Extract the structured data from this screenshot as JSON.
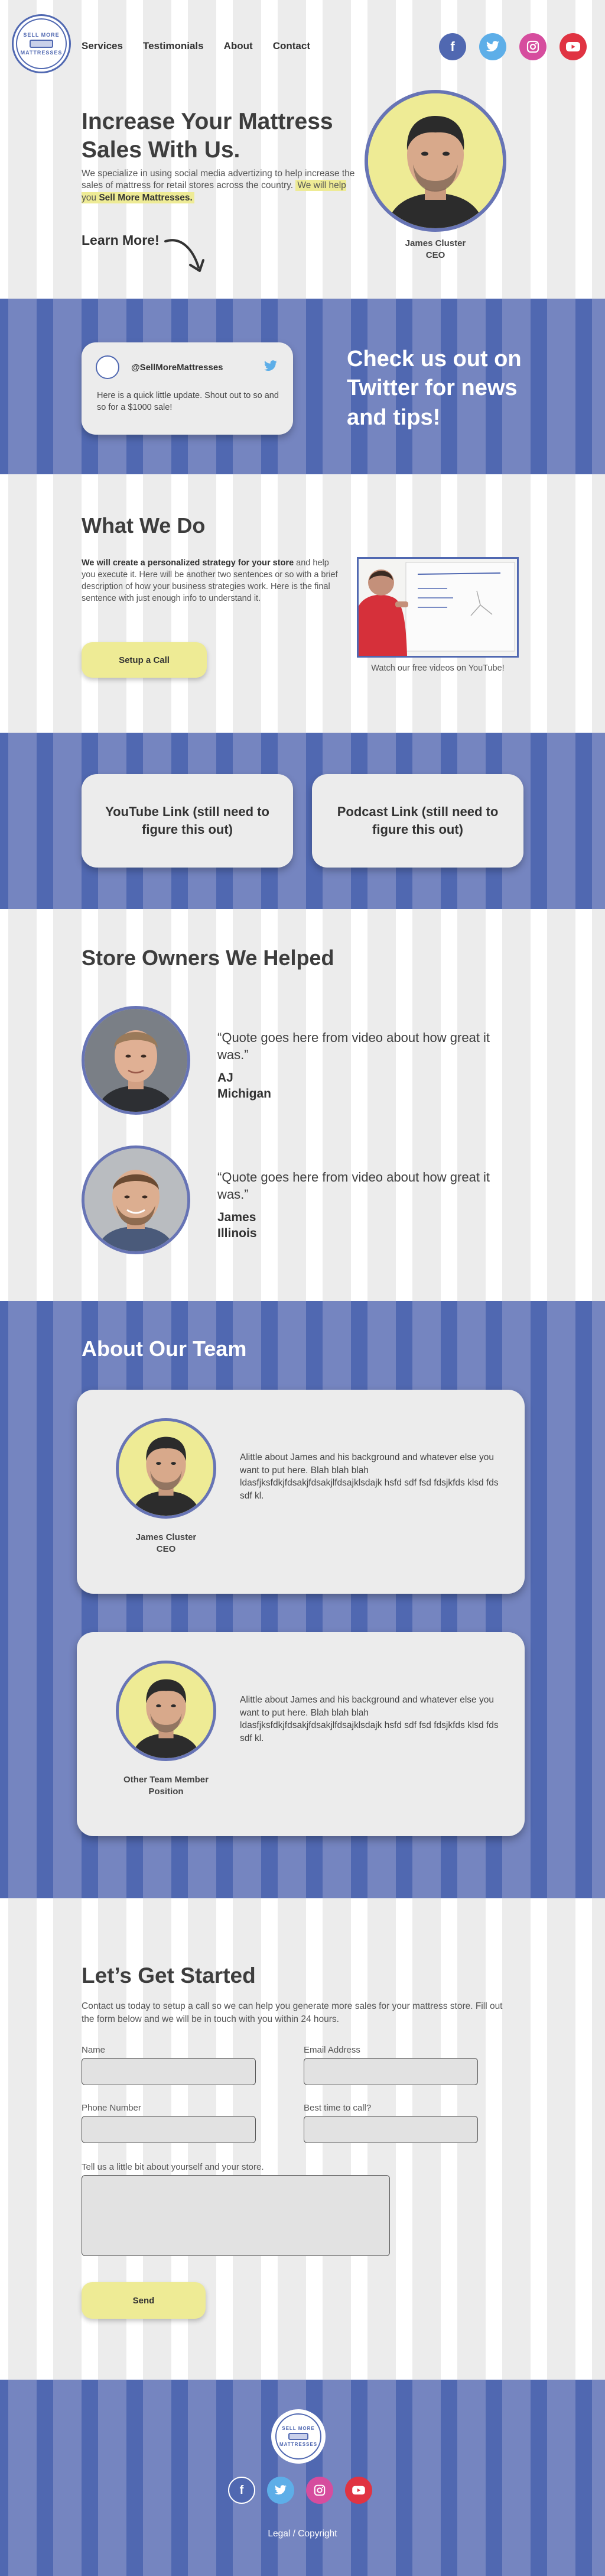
{
  "brand": {
    "logo_text_top": "SELL MORE",
    "logo_text_bottom": "MATTRESSES"
  },
  "nav": {
    "items": [
      "Services",
      "Testimonials",
      "About",
      "Contact"
    ]
  },
  "social_icons": [
    "facebook-icon",
    "twitter-icon",
    "instagram-icon",
    "youtube-icon"
  ],
  "hero": {
    "title": "Increase Your Mattress Sales With Us.",
    "text": "We specialize in using social media advertizing to help increase the sales of mattress for retail stores across the country.",
    "highlight_prefix": "We will help you ",
    "highlight_bold": "Sell More Mattresses.",
    "learn_more": "Learn More!",
    "ceo_name": "James Cluster",
    "ceo_title": "CEO"
  },
  "twitter": {
    "handle": "@SellMoreMattresses",
    "tweet": "Here is a quick little update. Shout out to so and so for a $1000 sale!",
    "heading": "Check us out on Twitter for news and tips!"
  },
  "what_we_do": {
    "title": "What We Do",
    "text_bold": "We will create a personalized strategy for your store",
    "text_rest": " and help you execute it. Here will be another two sentences or so with a brief description of how your business strategies work. Here is the final sentence with just enough info to understand it.",
    "button": "Setup a Call",
    "video_caption": "Watch our free videos on YouTube!"
  },
  "links": {
    "youtube": "YouTube Link (still need to figure this out)",
    "podcast": "Podcast Link (still need to figure this out)"
  },
  "owners": {
    "title": "Store Owners We Helped",
    "items": [
      {
        "quote": "“Quote goes here from video about how great it was.”",
        "name": "AJ",
        "location": "Michigan"
      },
      {
        "quote": "“Quote goes here from video about how great it was.”",
        "name": "James",
        "location": "Illinois"
      }
    ]
  },
  "team": {
    "title": "About Our Team",
    "members": [
      {
        "name": "James Cluster",
        "role": "CEO",
        "bio": "Alittle about James and his background and whatever else you want to put here. Blah blah blah ldasfjksfdkjfdsakjfdsakjlfdsajklsdajk hsfd  sdf fsd fdsjkfds klsd fds sdf kl."
      },
      {
        "name": "Other Team Member",
        "role": "Position",
        "bio": "Alittle about James and his background and whatever else you want to put here. Blah blah blah ldasfjksfdkjfdsakjfdsakjlfdsajklsdajk hsfd  sdf fsd fdsjkfds klsd fds sdf kl."
      }
    ]
  },
  "form": {
    "title": "Let’s Get Started",
    "intro": "Contact us today to setup a call so we can help you generate more sales for your mattress store. Fill out the form below and we will be in touch with you within 24 hours.",
    "name_label": "Name",
    "email_label": "Email Address",
    "phone_label": "Phone Number",
    "time_label": "Best time to call?",
    "about_label": "Tell us a little bit about yourself and your store.",
    "send": "Send"
  },
  "footer": {
    "legal": "Legal / Copyright"
  },
  "colors": {
    "brand_blue": "#5068b1",
    "stripe_blue": "#7585c0",
    "accent_yellow": "#eeeb95",
    "twitter_blue": "#5daee8",
    "instagram_pink": "#d64d9e",
    "youtube_red": "#e03342"
  }
}
